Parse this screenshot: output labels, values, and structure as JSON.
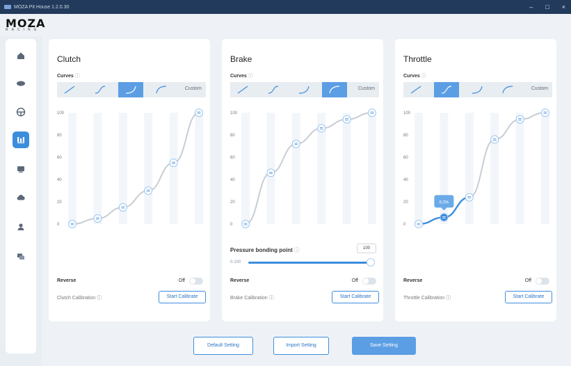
{
  "window": {
    "title": "MOZA Pit House 1.2.0.30",
    "minimize": "–",
    "maximize": "□",
    "close": "×"
  },
  "logo": {
    "word": "MOZA",
    "sub": "RACING"
  },
  "sidebar": {
    "items": [
      {
        "icon": "home-icon"
      },
      {
        "icon": "wheelbase-icon"
      },
      {
        "icon": "steering-wheel-icon"
      },
      {
        "icon": "pedals-icon",
        "active": true
      },
      {
        "icon": "dashboard-icon"
      },
      {
        "icon": "cloud-icon"
      },
      {
        "icon": "user-icon"
      },
      {
        "icon": "feedback-icon"
      }
    ]
  },
  "panels": {
    "clutch": {
      "title": "Clutch",
      "curves_label": "Curves",
      "custom_label": "Custom",
      "active_preset": 2,
      "y_ticks": [
        "100",
        "80",
        "60",
        "40",
        "20",
        "0"
      ],
      "points": [
        0,
        5,
        15,
        30,
        55,
        100
      ],
      "reverse_label": "Reverse",
      "reverse_state": "Off",
      "calibration_label": "Clutch Calibration",
      "calibrate_button": "Start Calibrate"
    },
    "brake": {
      "title": "Brake",
      "curves_label": "Curves",
      "custom_label": "Custom",
      "active_preset": 3,
      "y_ticks": [
        "100",
        "80",
        "60",
        "40",
        "20",
        "0"
      ],
      "points": [
        0,
        46,
        72,
        86,
        94,
        100
      ],
      "pressure_label": "Pressure bonding point",
      "pressure_value": "100",
      "pressure_range": "0-100",
      "reverse_label": "Reverse",
      "reverse_state": "Off",
      "calibration_label": "Brake Calibration",
      "calibrate_button": "Start Calibrate"
    },
    "throttle": {
      "title": "Throttle",
      "curves_label": "Curves",
      "custom_label": "Custom",
      "active_preset": 1,
      "y_ticks": [
        "100",
        "80",
        "60",
        "40",
        "20",
        "0"
      ],
      "points": [
        0,
        6,
        24,
        76,
        94,
        100
      ],
      "tooltip": "6.0%",
      "reverse_label": "Reverse",
      "reverse_state": "Off",
      "calibration_label": "Throttle Calibration",
      "calibrate_button": "Start Calibrate"
    }
  },
  "footer": {
    "default_button": "Default Setting",
    "import_button": "Import Setting",
    "save_button": "Save Setting"
  },
  "colors": {
    "accent": "#3d8ddd",
    "titlebar": "#223a5c",
    "curve_gray": "#c8cdd3"
  }
}
